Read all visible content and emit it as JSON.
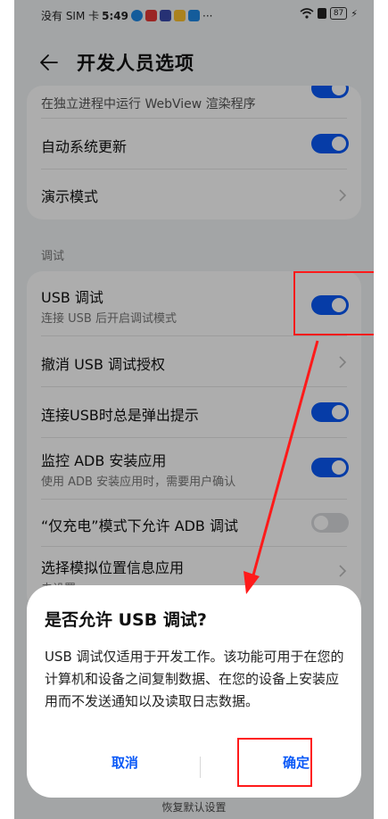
{
  "status_bar": {
    "left_text": "没有 SIM 卡",
    "time": "5:49",
    "dots": "···",
    "battery": "87",
    "colors": {
      "app1": "#1e88e5",
      "app2": "#e53935",
      "app3": "#3949ab",
      "app4": "#fbc02d",
      "app5": "#1e88e5"
    }
  },
  "header": {
    "back_icon": "back-arrow-icon",
    "title": "开发人员选项"
  },
  "card_top": {
    "rows": [
      {
        "title": "在独立进程中运行 WebView 渲染程序",
        "toggle": "on"
      },
      {
        "title": "自动系统更新",
        "toggle": "on"
      },
      {
        "title": "演示模式",
        "icon": "chevron-right-icon"
      }
    ]
  },
  "section_debug": {
    "label": "调试"
  },
  "card_debug": {
    "rows": [
      {
        "title": "USB 调试",
        "subtitle": "连接 USB 后开启调试模式",
        "toggle": "on"
      },
      {
        "title": "撤消 USB 调试授权",
        "icon": "chevron-right-icon"
      },
      {
        "title": "连接USB时总是弹出提示",
        "toggle": "on"
      },
      {
        "title": "监控 ADB 安装应用",
        "subtitle": "使用 ADB 安装应用时，需要用户确认",
        "toggle": "on"
      },
      {
        "title": "“仅充电”模式下允许 ADB 调试",
        "toggle": "off"
      },
      {
        "title": "选择模拟位置信息应用",
        "subtitle": "未设置",
        "icon": "chevron-right-icon"
      }
    ]
  },
  "dialog": {
    "title": "是否允许 USB 调试?",
    "body": "USB 调试仅适用于开发工作。该功能可用于在您的计算机和设备之间复制数据、在您的设备上安装应用而不发送通知以及读取日志数据。",
    "cancel": "取消",
    "confirm": "确定"
  },
  "bottom_hint": "恢复默认设置",
  "colors": {
    "accent": "#0a59f7",
    "highlight": "#ff1a1a"
  }
}
